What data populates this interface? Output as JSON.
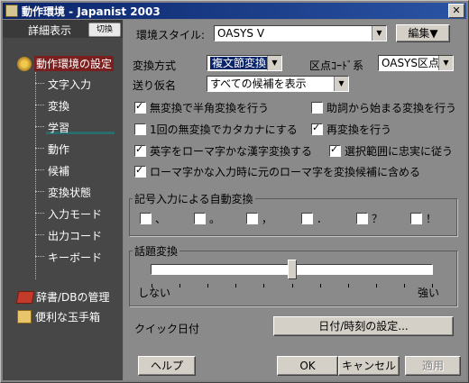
{
  "window": {
    "title": "動作環境 - Japanist 2003"
  },
  "sidebar": {
    "header_label": "詳細表示",
    "toggle_label": "切換",
    "root_label": "動作環境の設定",
    "items": [
      {
        "label": "文字入力"
      },
      {
        "label": "変換"
      },
      {
        "label": "学習"
      },
      {
        "label": "動作"
      },
      {
        "label": "候補"
      },
      {
        "label": "変換状態"
      },
      {
        "label": "入力モード"
      },
      {
        "label": "出力コード"
      },
      {
        "label": "キーボード"
      }
    ],
    "dict_label": "辞書/DBの管理",
    "box_label": "便利な玉手箱"
  },
  "style_row": {
    "label": "環境スタイル:",
    "value": "OASYS V",
    "edit_label": "編集▼"
  },
  "conversion": {
    "method_label": "変換方式",
    "method_value": "複文節変換",
    "kuten_label": "区点ｺｰﾄﾞ系",
    "kuten_value": "OASYS区点",
    "okuri_label": "送り仮名",
    "okuri_value": "すべての候補を表示"
  },
  "checks": [
    {
      "label": "無変換で半角変換を行う",
      "checked": true
    },
    {
      "label": "助詞から始まる変換を行う",
      "checked": false
    },
    {
      "label": "1回の無変換でカタカナにする",
      "checked": false
    },
    {
      "label": "再変換を行う",
      "checked": true
    },
    {
      "label": "英字をローマ字かな漢字変換する",
      "checked": true
    },
    {
      "label": "選択範囲に忠実に従う",
      "checked": true
    },
    {
      "label": "ローマ字かな入力時に元のローマ字を変換候補に含める",
      "checked": true
    }
  ],
  "symbol_group": {
    "title": "記号入力による自動変換",
    "items": [
      {
        "label": "、",
        "checked": false
      },
      {
        "label": "。",
        "checked": false
      },
      {
        "label": "，",
        "checked": false
      },
      {
        "label": "．",
        "checked": false
      },
      {
        "label": "？",
        "checked": false
      },
      {
        "label": "！",
        "checked": false
      }
    ]
  },
  "topic_group": {
    "title": "話題変換",
    "min_label": "しない",
    "max_label": "強い",
    "level": 0.5
  },
  "quick_date": {
    "label": "クイック日付",
    "button_label": "日付/時刻の設定..."
  },
  "footer": {
    "help_label": "ヘルプ",
    "ok_label": "OK",
    "cancel_label": "キャンセル",
    "apply_label": "適用"
  }
}
